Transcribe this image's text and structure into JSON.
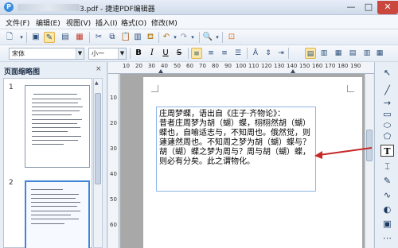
{
  "window": {
    "title": "3.pdf - 捷速PDF编辑器",
    "buttons": {
      "minimize": "—",
      "maximize": "□",
      "close": "✕"
    }
  },
  "menu": [
    {
      "label": "文件(F)"
    },
    {
      "label": "编辑(E)"
    },
    {
      "label": "视图(V)"
    },
    {
      "label": "插入(I)"
    },
    {
      "label": "格式(O)"
    },
    {
      "label": "修改(M)"
    }
  ],
  "format_bar": {
    "font_name": "宋体",
    "font_size": "小一",
    "bold": "B",
    "italic": "I",
    "underline": "U",
    "strike": "S"
  },
  "thumbnails": {
    "title": "页面缩略图",
    "close_glyph": "×",
    "pages": [
      {
        "number": "1"
      },
      {
        "number": "2"
      }
    ]
  },
  "ruler": {
    "labels": [
      "10",
      "20",
      "30",
      "40",
      "50",
      "60",
      "70",
      "80",
      "90",
      "100",
      "110",
      "120",
      "130",
      "140",
      "150",
      "160",
      "170",
      "180",
      "190"
    ],
    "v_labels": [
      "10",
      "20",
      "30",
      "40",
      "50",
      "60"
    ]
  },
  "document": {
    "lines": [
      "庄周梦蝶，语出自《庄子·齐物论》：",
      "昔者庄周梦为胡（蝴）蝶，栩栩然胡（蝴）",
      "蝶也，自喻适志与，不知周也。俄然觉，则",
      "蘧蘧然周也。不知周之梦为胡（蝴）蝶与？",
      "胡（蝴）蝶之梦为周与？周与胡（蝴）蝶，",
      "则必有分矣。此之谓物化。"
    ]
  },
  "tools": {
    "text_tool": "T",
    "accent": "#c62828"
  }
}
